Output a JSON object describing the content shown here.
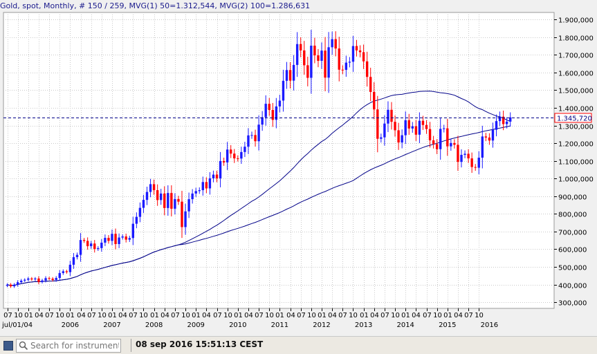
{
  "header": {
    "instrument": "Gold, spot",
    "period": "Monthly",
    "range": "# 150 / 259",
    "mvg1": "MVG(1) 50=1.312,544",
    "mvg2": "MVG(2) 100=1.286,631"
  },
  "status": {
    "search_placeholder": "Search for instrument",
    "datetime": "08 sep 2016 15:51:13 CEST"
  },
  "colors": {
    "bull": "#1a1aff",
    "bear": "#ff0000",
    "ma": "#000088",
    "grid": "#c8c8c8",
    "price_line": "#000088",
    "price_box_border": "#ff0000"
  },
  "chart_data": {
    "type": "candlestick",
    "title": "Gold, spot, Monthly",
    "x_start_label": "jul/01/04",
    "year_labels": [
      "2006",
      "2007",
      "2008",
      "2009",
      "2010",
      "2011",
      "2012",
      "2013",
      "2014",
      "2015",
      "2016"
    ],
    "month_tick_labels": [
      "07",
      "10",
      "01",
      "04",
      "07",
      "10",
      "01",
      "04",
      "07",
      "10",
      "01",
      "04",
      "07",
      "10",
      "01",
      "04",
      "07",
      "10",
      "01",
      "04",
      "07",
      "10",
      "01",
      "04",
      "07",
      "10",
      "01",
      "04",
      "07",
      "10",
      "01",
      "04",
      "07",
      "10",
      "01",
      "04",
      "07",
      "10",
      "01",
      "04",
      "07",
      "10",
      "01",
      "04",
      "07",
      "10"
    ],
    "y_ticks": [
      {
        "v": 300,
        "label": "300,000"
      },
      {
        "v": 400,
        "label": "400,000"
      },
      {
        "v": 500,
        "label": "500,000"
      },
      {
        "v": 600,
        "label": "600,000"
      },
      {
        "v": 700,
        "label": "700,000"
      },
      {
        "v": 800,
        "label": "800,000"
      },
      {
        "v": 900,
        "label": "900,000"
      },
      {
        "v": 1000,
        "label": "1.000,000"
      },
      {
        "v": 1100,
        "label": "1.100,000"
      },
      {
        "v": 1200,
        "label": "1.200,000"
      },
      {
        "v": 1300,
        "label": "1.300,000"
      },
      {
        "v": 1400,
        "label": "1.400,000"
      },
      {
        "v": 1500,
        "label": "1.500,000"
      },
      {
        "v": 1600,
        "label": "1.600,000"
      },
      {
        "v": 1700,
        "label": "1.700,000"
      },
      {
        "v": 1800,
        "label": "1.800,000"
      },
      {
        "v": 1900,
        "label": "1.900,000"
      }
    ],
    "ylim": [
      265,
      1940
    ],
    "current_price": 1345.72,
    "current_price_label": "1.345,720",
    "close": [
      399,
      390,
      399,
      413,
      422,
      427,
      434,
      429,
      434,
      415,
      423,
      436,
      433,
      426,
      437,
      465,
      475,
      470,
      512,
      555,
      568,
      652,
      647,
      617,
      632,
      601,
      606,
      637,
      664,
      647,
      687,
      629,
      666,
      672,
      654,
      663,
      744,
      783,
      834,
      879,
      924,
      968,
      934,
      878,
      915,
      833,
      918,
      829,
      884,
      869,
      725,
      814,
      883,
      915,
      929,
      934,
      980,
      944,
      1001,
      1022,
      1001,
      1099,
      1091,
      1164,
      1141,
      1114,
      1113,
      1150,
      1180,
      1244,
      1246,
      1211,
      1305,
      1347,
      1423,
      1388,
      1332,
      1408,
      1441,
      1553,
      1614,
      1554,
      1643,
      1761,
      1725,
      1641,
      1570,
      1752,
      1697,
      1666,
      1724,
      1571,
      1743,
      1789,
      1736,
      1616,
      1615,
      1656,
      1661,
      1750,
      1725,
      1715,
      1663,
      1575,
      1490,
      1391,
      1225,
      1233,
      1311,
      1389,
      1321,
      1273,
      1204,
      1245,
      1330,
      1283,
      1296,
      1248,
      1327,
      1303,
      1280,
      1216,
      1195,
      1166,
      1281,
      1284,
      1182,
      1201,
      1191,
      1094,
      1134,
      1140,
      1114,
      1065,
      1061,
      1118,
      1238,
      1232,
      1215,
      1276,
      1325,
      1350,
      1308,
      1322,
      1346
    ],
    "ma1_label": "MVG(1) 50",
    "ma1_end": 1312.544,
    "ma2_label": "MVG(2) 100",
    "ma2_end": 1286.631
  }
}
